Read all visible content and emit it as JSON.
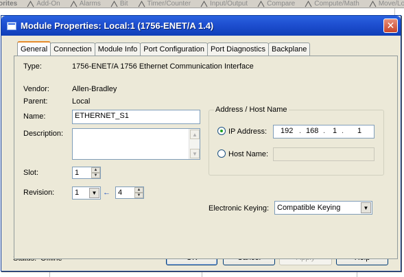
{
  "background": {
    "tabs": [
      {
        "label": "orites"
      },
      {
        "label": "Add-On"
      },
      {
        "label": "Alarms"
      },
      {
        "label": "Bit"
      },
      {
        "label": "Timer/Counter"
      },
      {
        "label": "Input/Output"
      },
      {
        "label": "Compare"
      },
      {
        "label": "Compute/Math"
      },
      {
        "label": "Move/Logic"
      }
    ]
  },
  "dialog": {
    "title": "Module Properties: Local:1 (1756-ENET/A 1.4)",
    "close_icon": "close-icon",
    "tabs": [
      {
        "label": "General",
        "active": true
      },
      {
        "label": "Connection"
      },
      {
        "label": "Module Info"
      },
      {
        "label": "Port Configuration"
      },
      {
        "label": "Port Diagnostics"
      },
      {
        "label": "Backplane"
      }
    ],
    "general": {
      "type_label": "Type:",
      "type_value": "1756-ENET/A 1756 Ethernet Communication Interface",
      "vendor_label": "Vendor:",
      "vendor_value": "Allen-Bradley",
      "parent_label": "Parent:",
      "parent_value": "Local",
      "name_label": "Name:",
      "name_value": "ETHERNET_S1",
      "description_label": "Description:",
      "description_value": "",
      "slot_label": "Slot:",
      "slot_value": "1",
      "revision_label": "Revision:",
      "revision_major": "1",
      "revision_minor": "4",
      "address_group_label": "Address / Host Name",
      "ip_address_label": "IP Address:",
      "ip_octets": [
        "192",
        "168",
        "1",
        "1"
      ],
      "host_name_label": "Host Name:",
      "host_name_value": "",
      "ip_selected": true,
      "keying_label": "Electronic Keying:",
      "keying_value": "Compatible Keying"
    },
    "status_label": "Status:",
    "status_value": "Offline",
    "buttons": {
      "ok": "OK",
      "cancel": "Cancel",
      "apply": "Apply",
      "help": "Help"
    }
  }
}
